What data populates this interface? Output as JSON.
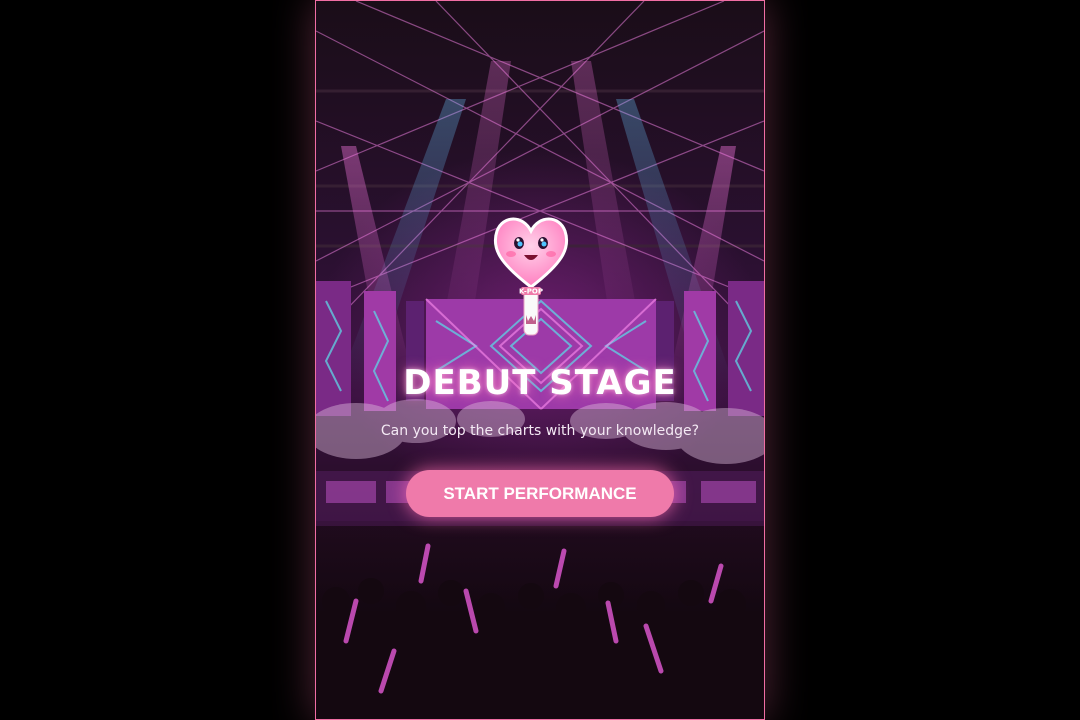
{
  "screen": {
    "title": "DEBUT STAGE",
    "subtitle": "Can you top the charts with your knowledge?",
    "start_button_label": "START PERFORMANCE"
  },
  "light_stick": {
    "icon": "heart-light-stick-icon",
    "label": "K-POP"
  },
  "colors": {
    "accent": "#ef7aaa",
    "border": "#f06ea4",
    "laser": "#e06ad6",
    "beam_blue": "#5fb8e8"
  }
}
